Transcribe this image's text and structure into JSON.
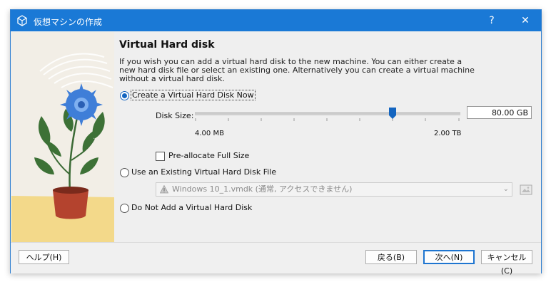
{
  "window": {
    "title": "仮想マシンの作成",
    "help_symbol": "?",
    "close_symbol": "✕"
  },
  "page": {
    "heading": "Virtual Hard disk",
    "description": "If you wish you can add a virtual hard disk to the new machine. You can either create a new hard disk file or select an existing one. Alternatively you can create a virtual machine without a virtual hard disk."
  },
  "options": {
    "create_new": {
      "label": "Create a Virtual Hard Disk Now",
      "selected": true
    },
    "use_existing": {
      "label": "Use an Existing Virtual Hard Disk File",
      "selected": false
    },
    "no_disk": {
      "label": "Do Not Add a Virtual Hard Disk",
      "selected": false
    }
  },
  "disk_size": {
    "label": "Disk Size:",
    "value": "80.00 GB",
    "min_label": "4.00 MB",
    "max_label": "2.00 TB"
  },
  "preallocate": {
    "label": "Pre-allocate Full Size",
    "checked": false
  },
  "existing_file": {
    "value": "Windows 10_1.vmdk (通常, アクセスできません)",
    "icon": "warning-icon"
  },
  "footer": {
    "help_label": "ヘルプ(H)",
    "back_label": "戻る(B)",
    "next_label": "次へ(N)",
    "cancel_label": "キャンセル(C)"
  },
  "colors": {
    "titlebar": "#1a79d6",
    "accent": "#1465c0",
    "window_bg": "#efefef"
  }
}
